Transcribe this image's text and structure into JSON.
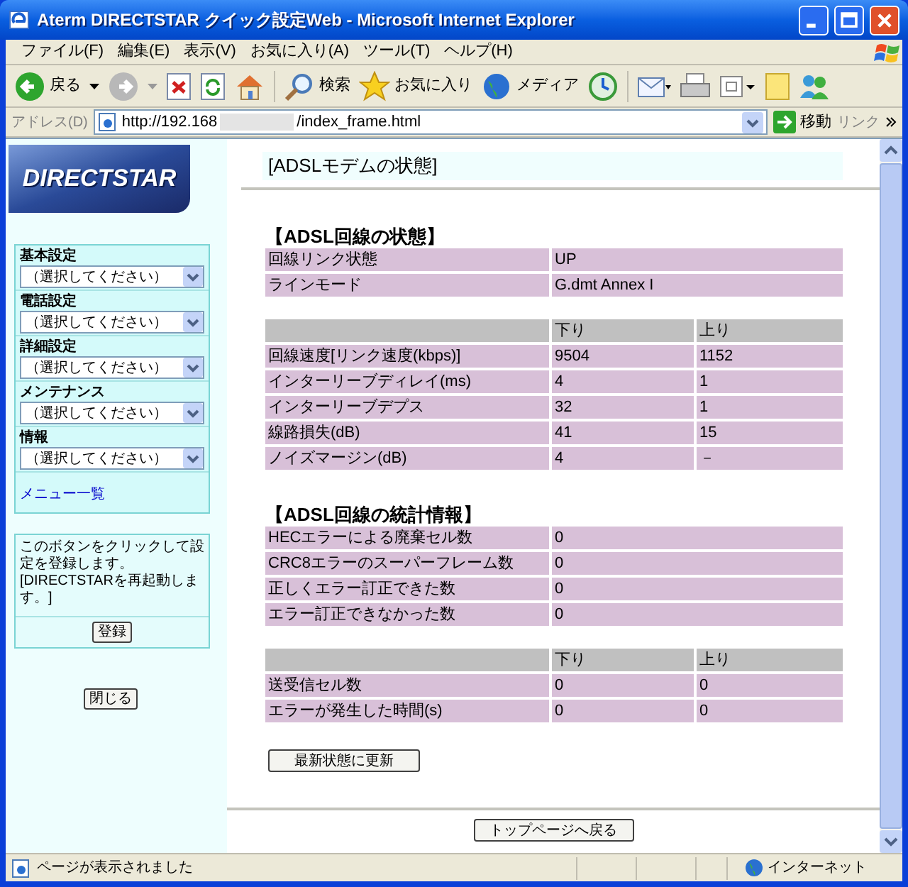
{
  "window": {
    "title": "Aterm DIRECTSTAR クイック設定Web - Microsoft Internet Explorer"
  },
  "menu_bar": [
    "ファイル(F)",
    "編集(E)",
    "表示(V)",
    "お気に入り(A)",
    "ツール(T)",
    "ヘルプ(H)"
  ],
  "toolbar": {
    "back_label": "戻る",
    "search_label": "検索",
    "favorites_label": "お気に入り",
    "media_label": "メディア"
  },
  "address_bar": {
    "label": "アドレス(D)",
    "url_start": "http://192.168",
    "url_end": "/index_frame.html",
    "go_label": "移動",
    "links_label": "リンク"
  },
  "sidebar": {
    "logo": "DIRECTSTAR",
    "menus": [
      {
        "label": "基本設定",
        "value": "（選択してください）"
      },
      {
        "label": "電話設定",
        "value": "（選択してください）"
      },
      {
        "label": "詳細設定",
        "value": "（選択してください）"
      },
      {
        "label": "メンテナンス",
        "value": "（選択してください）"
      },
      {
        "label": "情報",
        "value": "（選択してください）"
      }
    ],
    "menu_list_link": "メニュー一覧",
    "register_note": "このボタンをクリックして設定を登録します。[DIRECTSTARを再起動します。]",
    "register_button": "登録",
    "close_button": "閉じる"
  },
  "page": {
    "title": "[ADSLモデムの状態]",
    "sections": [
      {
        "heading": "【ADSL回線の状態】",
        "tables": [
          {
            "rows": [
              [
                "回線リンク状態",
                "UP"
              ],
              [
                "ラインモード",
                "G.dmt Annex I"
              ]
            ]
          },
          {
            "columns": [
              "",
              "下り",
              "上り"
            ],
            "rows": [
              [
                "回線速度[リンク速度(kbps)]",
                "9504",
                "1152"
              ],
              [
                "インターリーブディレイ(ms)",
                "4",
                "1"
              ],
              [
                "インターリーブデプス",
                "32",
                "1"
              ],
              [
                "線路損失(dB)",
                "41",
                "15"
              ],
              [
                "ノイズマージン(dB)",
                "4",
                "－"
              ]
            ]
          }
        ]
      },
      {
        "heading": "【ADSL回線の統計情報】",
        "tables": [
          {
            "rows": [
              [
                "HECエラーによる廃棄セル数",
                "0"
              ],
              [
                "CRC8エラーのスーパーフレーム数",
                "0"
              ],
              [
                "正しくエラー訂正できた数",
                "0"
              ],
              [
                "エラー訂正できなかった数",
                "0"
              ]
            ]
          },
          {
            "columns": [
              "",
              "下り",
              "上り"
            ],
            "rows": [
              [
                "送受信セル数",
                "0",
                "0"
              ],
              [
                "エラーが発生した時間(s)",
                "0",
                "0"
              ]
            ]
          }
        ]
      }
    ],
    "update_button": "最新状態に更新",
    "top_button": "トップページへ戻る"
  },
  "status_bar": {
    "text": "ページが表示されました",
    "zone": "インターネット"
  }
}
